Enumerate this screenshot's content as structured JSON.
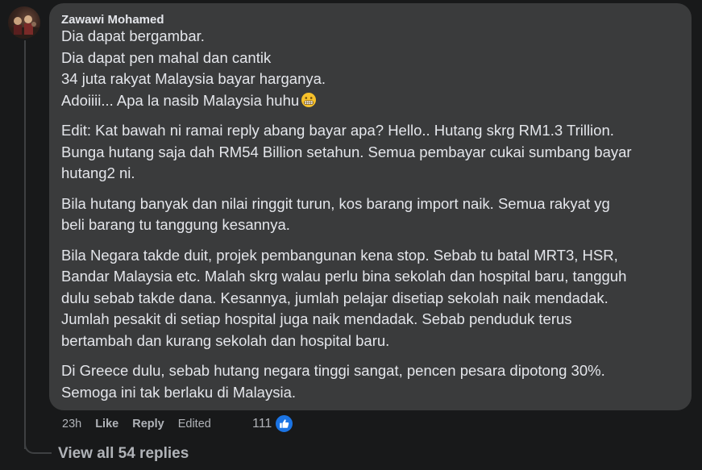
{
  "comment": {
    "author": "Zawawi Mohamed",
    "paragraphs": [
      {
        "lines": [
          "Dia dapat bergambar.",
          "Dia dapat pen mahal dan cantik",
          "34 juta rakyat Malaysia bayar harganya.",
          "Adoiiii... Apa la nasib Malaysia huhu"
        ],
        "trailing_emoji": "grimacing-face-emoji"
      },
      {
        "lines": [
          "Edit: Kat bawah ni ramai reply abang bayar apa? Hello.. Hutang skrg RM1.3 Trillion.",
          "Bunga hutang saja dah RM54 Billion setahun. Semua pembayar cukai sumbang bayar",
          "hutang2 ni."
        ]
      },
      {
        "lines": [
          "Bila hutang banyak dan nilai ringgit turun, kos barang import naik. Semua rakyat yg",
          "beli barang tu tanggung kesannya."
        ]
      },
      {
        "lines": [
          "Bila Negara takde duit, projek pembangunan kena stop. Sebab tu batal MRT3, HSR,",
          "Bandar Malaysia etc. Malah skrg walau perlu bina sekolah dan hospital baru, tangguh",
          "dulu sebab takde dana. Kesannya, jumlah pelajar disetiap sekolah naik mendadak.",
          "Jumlah pesakit di setiap hospital juga naik mendadak. Sebab penduduk terus",
          "bertambah dan kurang sekolah dan hospital baru."
        ]
      },
      {
        "lines": [
          "Di Greece dulu, sebab hutang negara tinggi sangat, pencen pesara dipotong 30%.",
          "Semoga ini tak berlaku di Malaysia."
        ]
      }
    ],
    "actions": {
      "time": "23h",
      "like": "Like",
      "reply": "Reply",
      "edited": "Edited"
    },
    "reactions": {
      "count": "111",
      "icon": "thumbs-up-icon"
    },
    "view_replies": "View all 54 replies"
  },
  "colors": {
    "background": "#18191a",
    "bubble": "#3a3b3c",
    "text": "#e4e6eb",
    "secondary_text": "#b0b3b8",
    "like_blue": "#1b74e4"
  }
}
